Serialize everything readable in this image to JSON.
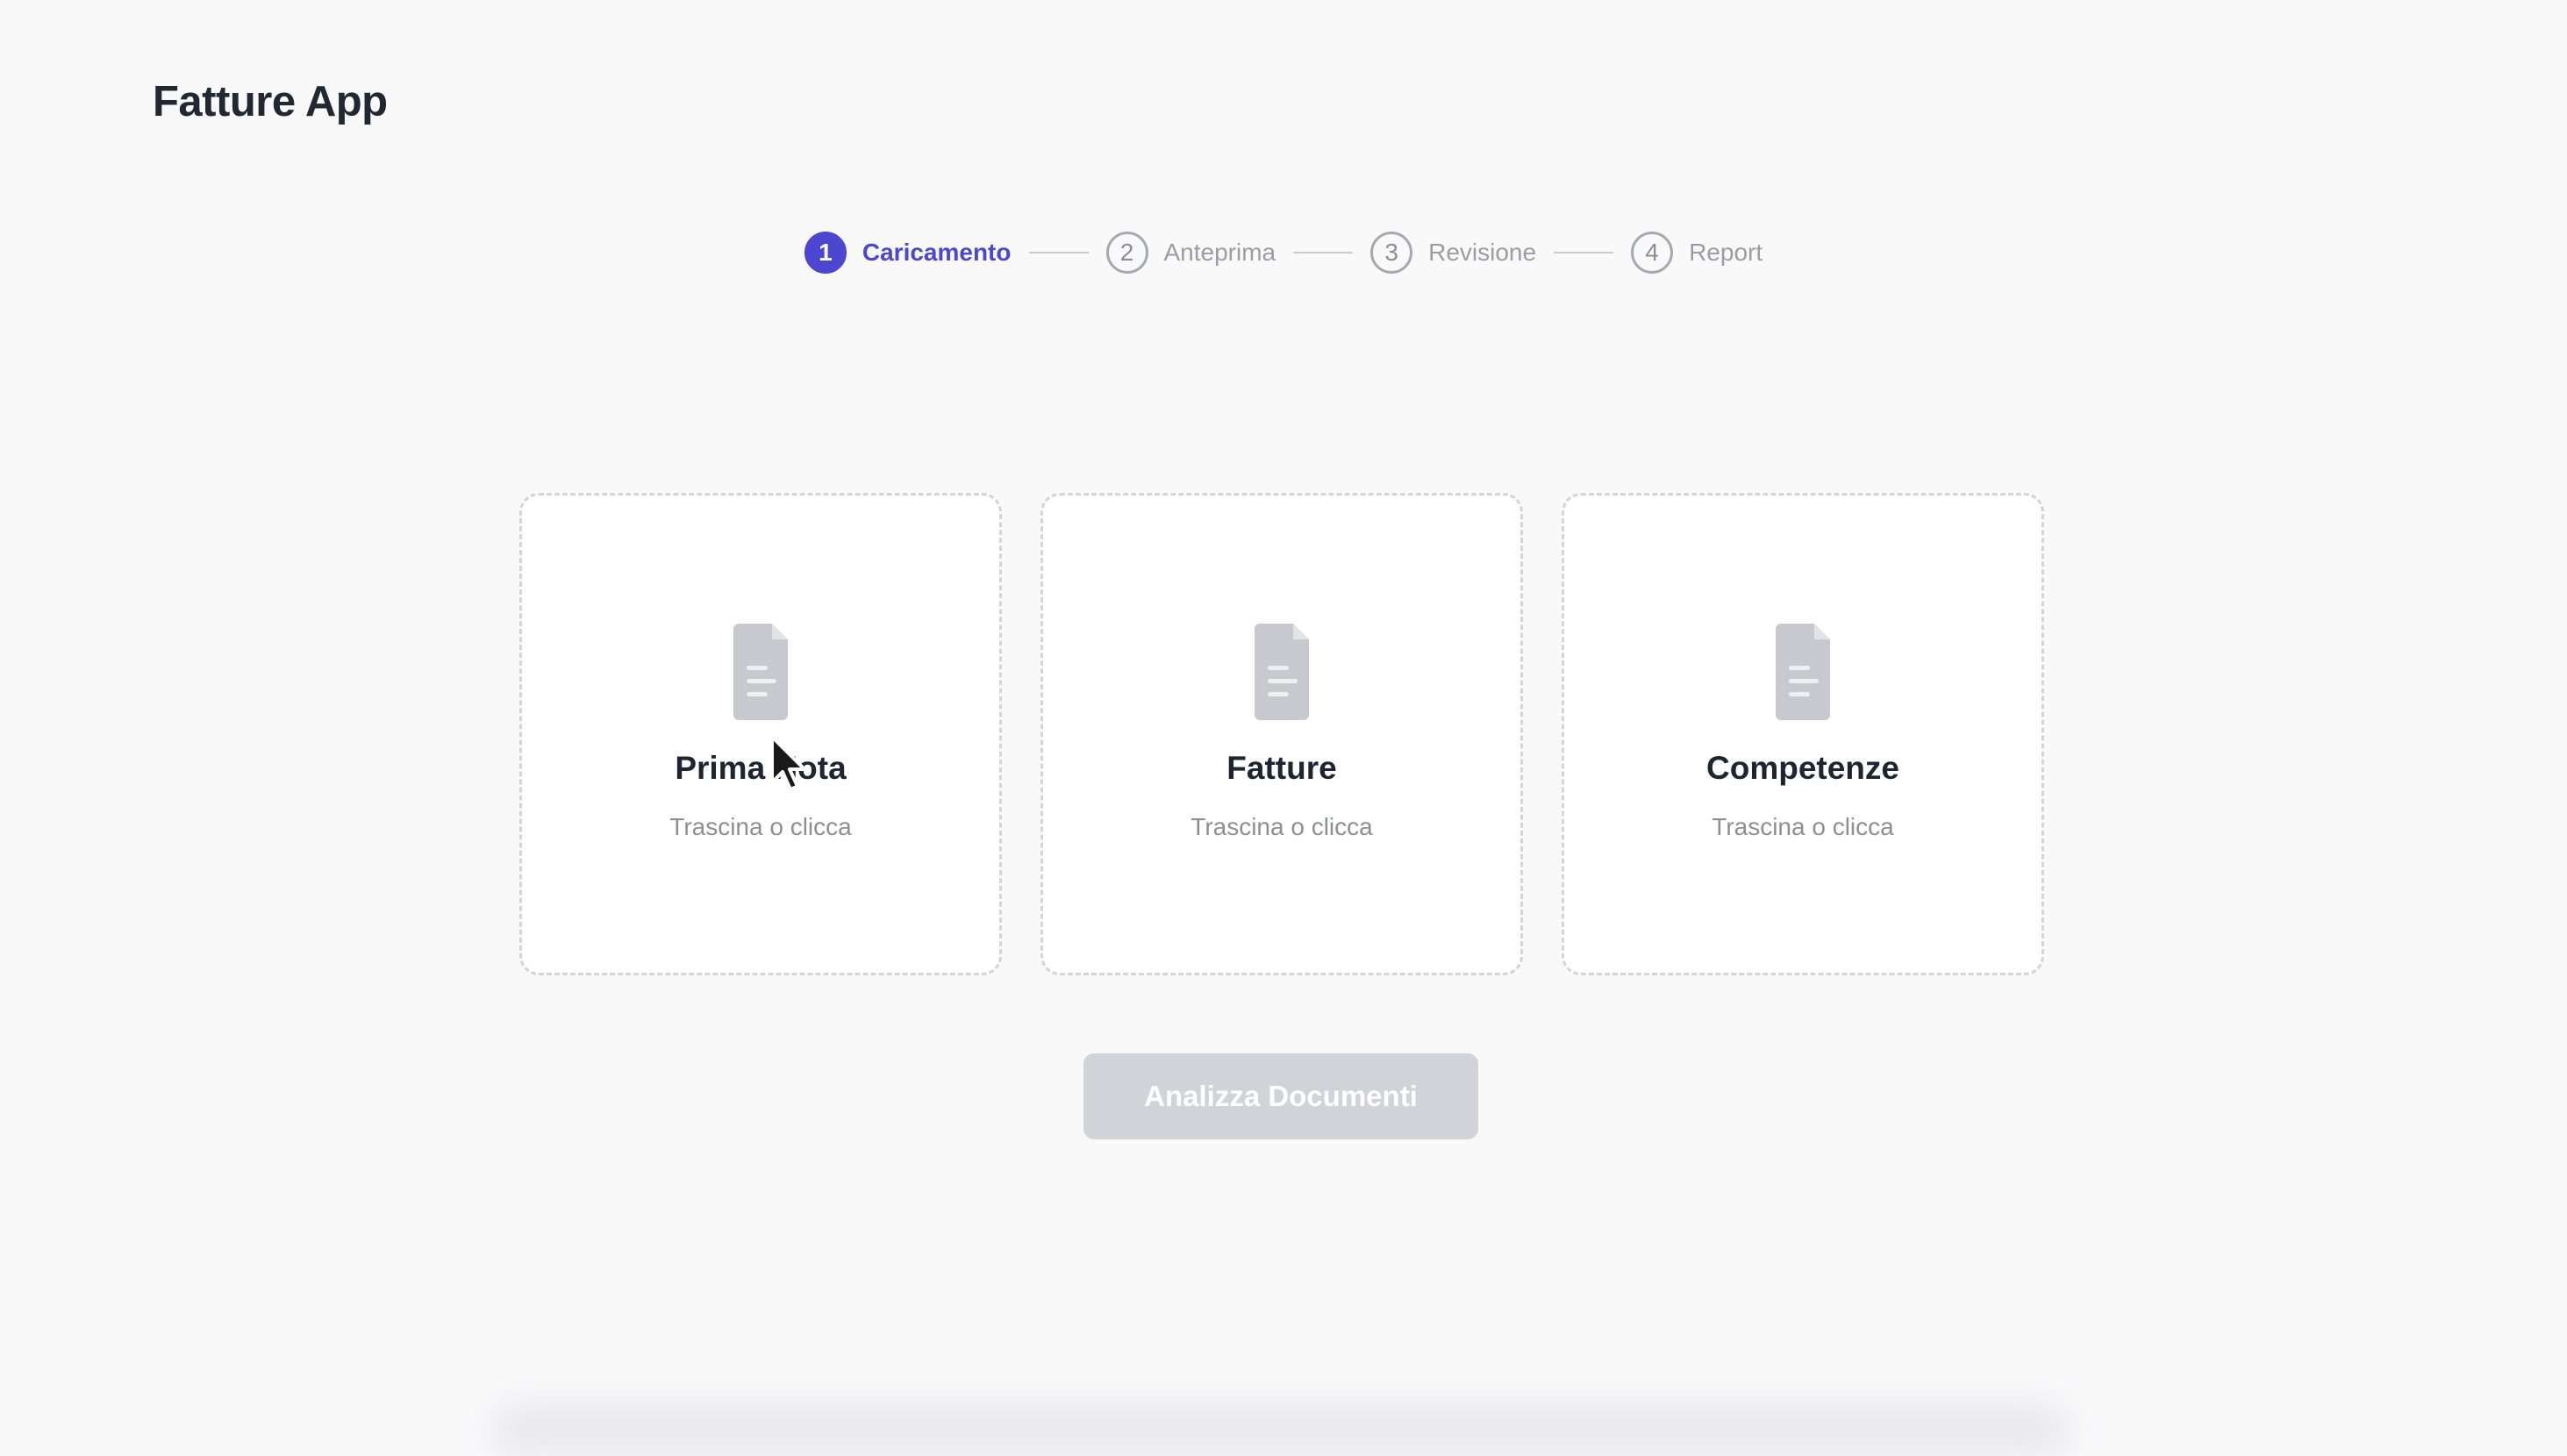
{
  "app": {
    "title": "Fatture App"
  },
  "stepper": {
    "current_step": 1,
    "steps": [
      {
        "number": "1",
        "label": "Caricamento",
        "active": true
      },
      {
        "number": "2",
        "label": "Anteprima",
        "active": false
      },
      {
        "number": "3",
        "label": "Revisione",
        "active": false
      },
      {
        "number": "4",
        "label": "Report",
        "active": false
      }
    ]
  },
  "uploads": [
    {
      "title": "Prima Nota",
      "hint": "Trascina o clicca",
      "icon": "document-icon"
    },
    {
      "title": "Fatture",
      "hint": "Trascina o clicca",
      "icon": "document-icon"
    },
    {
      "title": "Competenze",
      "hint": "Trascina o clicca",
      "icon": "document-icon"
    }
  ],
  "actions": {
    "analyze_label": "Analizza Documenti",
    "analyze_enabled": false
  },
  "colors": {
    "accent": "#4c46d1",
    "background": "#f9f9fa",
    "card_border": "#d3d5da",
    "icon_gray": "#c8c9ce",
    "disabled_button": "#d2d3d8"
  }
}
